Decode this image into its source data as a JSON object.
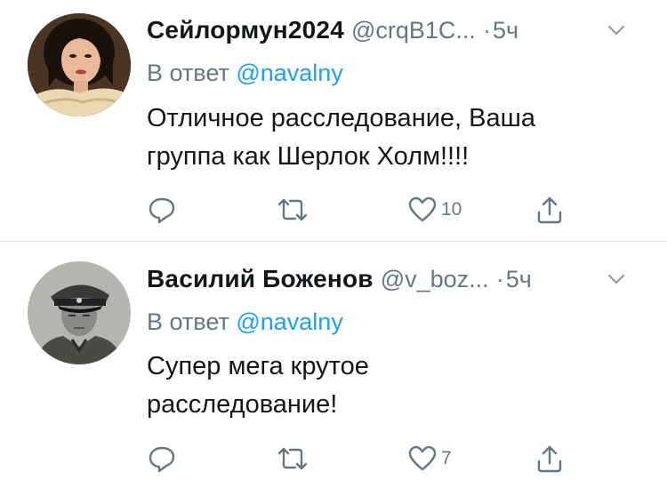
{
  "tweets": [
    {
      "display_name": "Сейлормун2024",
      "handle": "@crqB1C...",
      "separator": "·",
      "time": "5ч",
      "reply_prefix": "В ответ",
      "reply_to": "@navalny",
      "text_line1": "Отличное расследование, Ваша",
      "text_line2": "группа как Шерлок Холм!!!!",
      "like_count": "10",
      "avatar_icon": "woman-portrait-avatar"
    },
    {
      "display_name": "Василий Боженов",
      "handle": "@v_boz...",
      "separator": "·",
      "time": "5ч",
      "reply_prefix": "В ответ",
      "reply_to": "@navalny",
      "text_line1": "Супер мега крутое",
      "text_line2": "расследование!",
      "like_count": "7",
      "avatar_icon": "man-military-cap-avatar"
    }
  ],
  "icons": {
    "more": "chevron-down-icon",
    "reply": "reply-bubble-icon",
    "retweet": "retweet-icon",
    "like": "heart-icon",
    "share": "share-icon"
  },
  "colors": {
    "text": "#14171a",
    "secondary": "#657786",
    "link": "#1da1f2",
    "divider": "#e1e8ed"
  }
}
